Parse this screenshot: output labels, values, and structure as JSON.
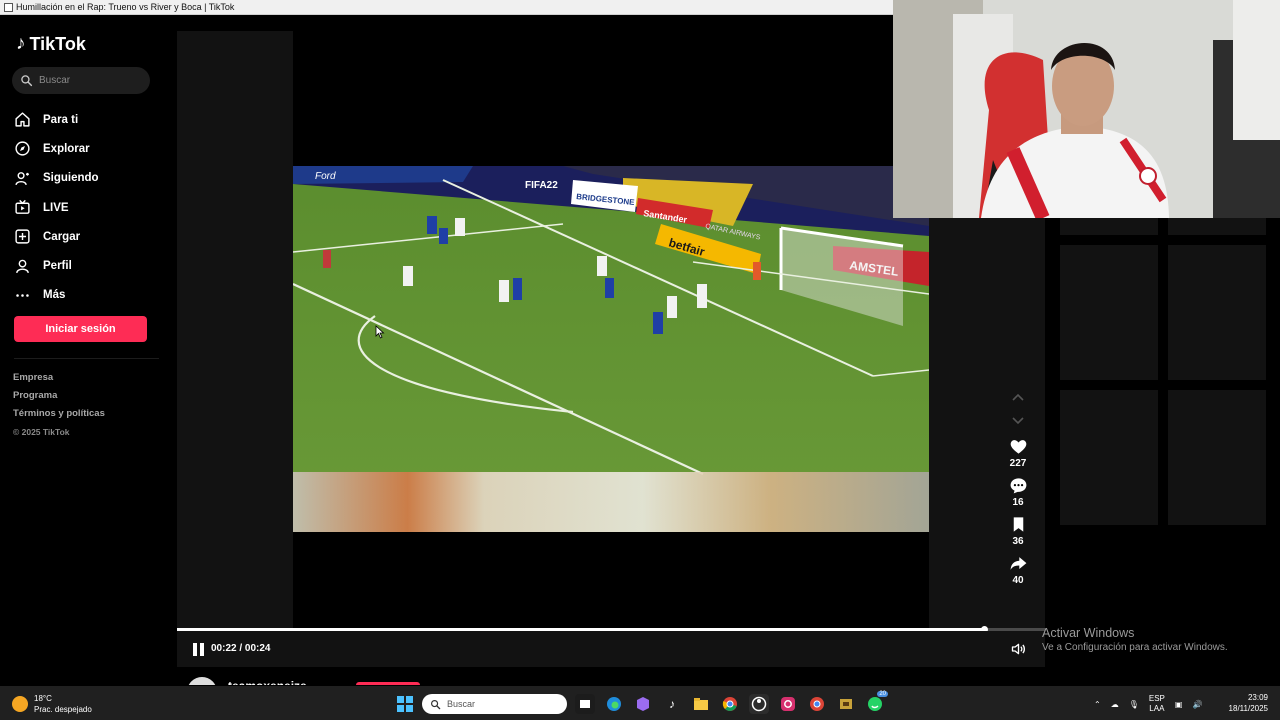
{
  "window": {
    "title": "Humillación en el Rap: Trueno vs River y Boca | TikTok"
  },
  "brand": {
    "name": "TikTok",
    "accent": "#fe2c55"
  },
  "sidebar": {
    "search_placeholder": "Buscar",
    "items": [
      {
        "label": "Para ti",
        "icon": "home-icon"
      },
      {
        "label": "Explorar",
        "icon": "compass-icon"
      },
      {
        "label": "Siguiendo",
        "icon": "following-icon"
      },
      {
        "label": "LIVE",
        "icon": "live-icon"
      },
      {
        "label": "Cargar",
        "icon": "upload-icon"
      },
      {
        "label": "Perfil",
        "icon": "profile-icon"
      },
      {
        "label": "Más",
        "icon": "more-icon"
      }
    ],
    "login_label": "Iniciar sesión",
    "footer": [
      "Empresa",
      "Programa",
      "Términos y políticas"
    ],
    "copyright": "© 2025 TikTok"
  },
  "video": {
    "ads": {
      "fifa": "FIFA22",
      "bridgestone": "BRIDGESTONE",
      "santander": "Santander",
      "qatar": "QATAR AIRWAYS",
      "betfair": "betfair",
      "amstel": "AMSTEL",
      "ford": "Ford"
    },
    "progress": 0.93,
    "time": "00:22 / 00:24"
  },
  "actions": {
    "likes": "227",
    "comments": "16",
    "saves": "36",
    "shares": "40"
  },
  "author": {
    "name": "teamoxeneize"
  },
  "watermark": {
    "line1": "Activar Windows",
    "line2": "Ve a Configuración para activar Windows."
  },
  "taskbar": {
    "weather_temp": "18°C",
    "weather_desc": "Prac. despejado",
    "search_placeholder": "Buscar",
    "lang_top": "ESP",
    "lang_bottom": "LAA",
    "time": "23:09",
    "date": "18/11/2025",
    "badge": "20"
  }
}
